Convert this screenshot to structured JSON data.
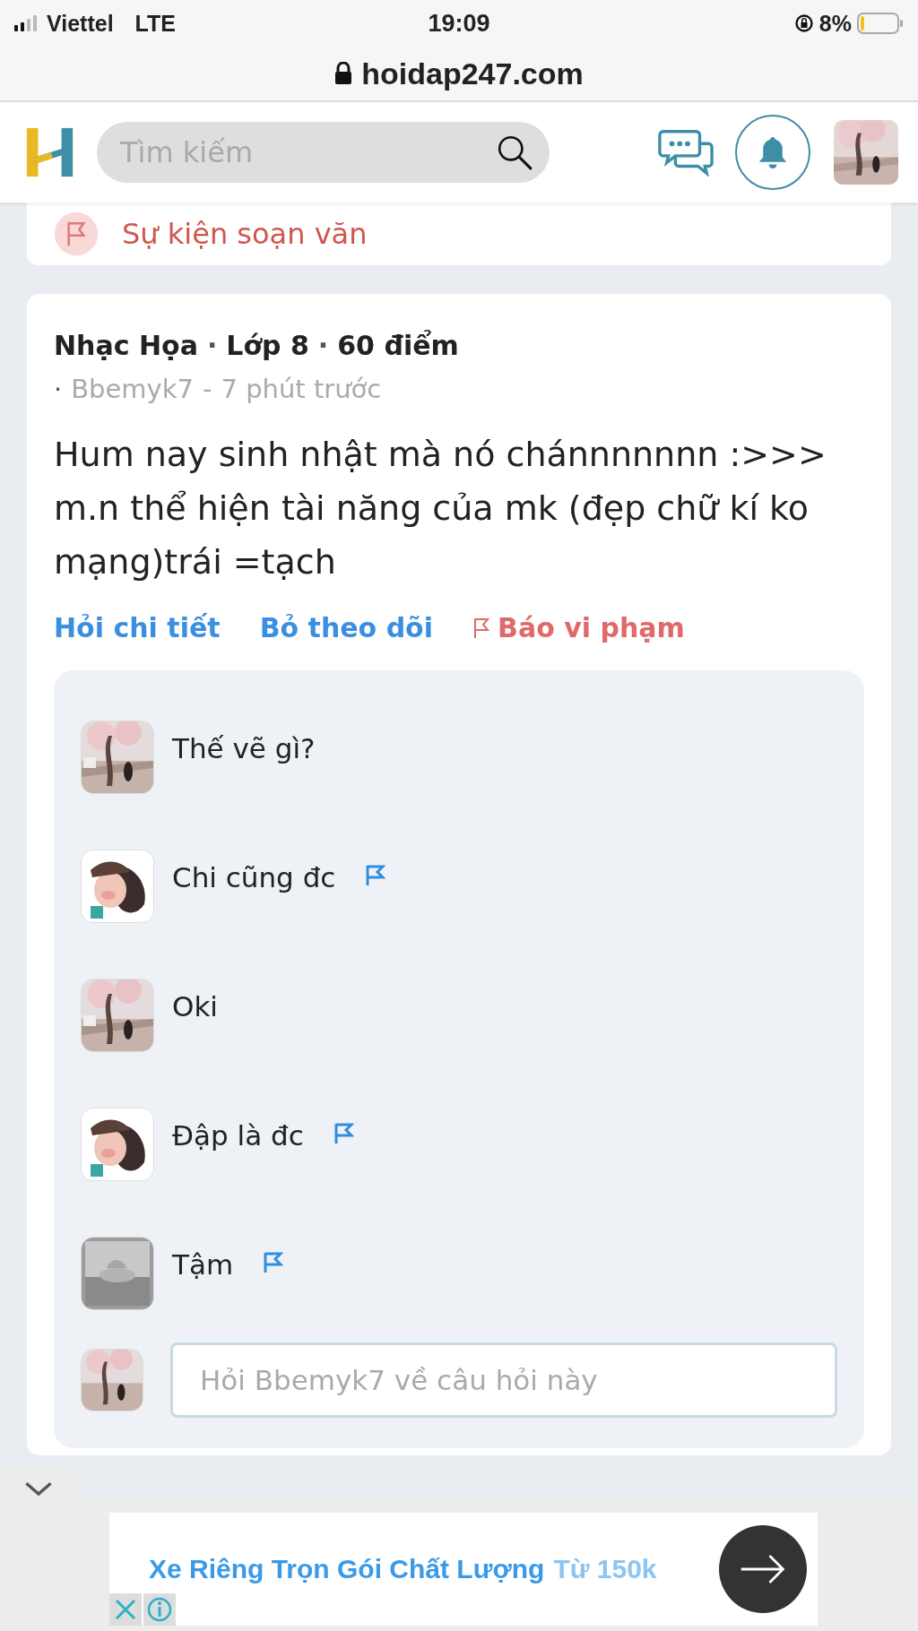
{
  "status_bar": {
    "carrier": "Viettel",
    "network": "LTE",
    "time": "19:09",
    "battery": "8%"
  },
  "address_bar": {
    "url": "hoidap247.com"
  },
  "header": {
    "search": {
      "placeholder": "Tìm kiếm"
    }
  },
  "event_card": {
    "label": "Sự kiện soạn văn"
  },
  "question": {
    "subject": "Nhạc Họa",
    "meta_separators": [
      "·",
      "·"
    ],
    "grade": "Lớp 8",
    "points": "60 điểm",
    "author_bullet": "·",
    "author": "Bbemyk7",
    "author_dash": "-",
    "time": "7 phút trước",
    "body": "Hum nay sinh nhật mà nó chánnnnnnn :>>> m.n thể hiện tài năng của mk (đẹp chữ kí ko mạng)trái =tạch",
    "actions": [
      {
        "label": "Hỏi chi tiết",
        "kind": "link"
      },
      {
        "label": "Bỏ theo dõi",
        "kind": "link"
      },
      {
        "label": "Báo vi phạm",
        "kind": "report"
      }
    ],
    "comments": [
      {
        "text": "Thế vẽ gì?",
        "reportable": false
      },
      {
        "text": "Chi cũng đc",
        "reportable": true
      },
      {
        "text": "Oki",
        "reportable": false
      },
      {
        "text": "Đập là đc",
        "reportable": true
      },
      {
        "text": "Tậm",
        "reportable": true
      }
    ],
    "reply": {
      "placeholder": "Hỏi Bbemyk7 về câu hỏi này"
    }
  },
  "ad": {
    "headline": "Xe Riêng Trọn Gói Chất Lượng",
    "price": "Từ 150k"
  }
}
